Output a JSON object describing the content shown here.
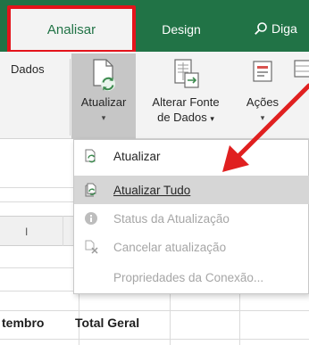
{
  "tabs": {
    "analisar": "Analisar",
    "design": "Design",
    "tell_me": "Diga"
  },
  "ribbon": {
    "group_dados": "Dados",
    "atualizar": "Atualizar",
    "alterar_fonte_line1": "Alterar Fonte",
    "alterar_fonte_line2": "de Dados",
    "acoes": "Ações",
    "caret": "▾"
  },
  "menu": {
    "items": [
      {
        "label": "Atualizar",
        "icon": "refresh-icon",
        "state": "normal"
      },
      {
        "label": "Atualizar Tudo",
        "icon": "refresh-all-icon",
        "state": "highlighted"
      },
      {
        "label": "Status da Atualização",
        "icon": "info-icon",
        "state": "disabled"
      },
      {
        "label": "Cancelar atualização",
        "icon": "cancel-refresh-icon",
        "state": "disabled"
      },
      {
        "label": "Propriedades da Conexão...",
        "icon": "",
        "state": "disabled"
      }
    ]
  },
  "sheet": {
    "column_header": "I",
    "row_label_partial": "tembro",
    "total_label": "Total Geral"
  },
  "colors": {
    "ribbon_green": "#217346",
    "highlight_red": "#e4141b",
    "arrow_red": "#e02020",
    "menu_hover": "#d6d6d6"
  }
}
